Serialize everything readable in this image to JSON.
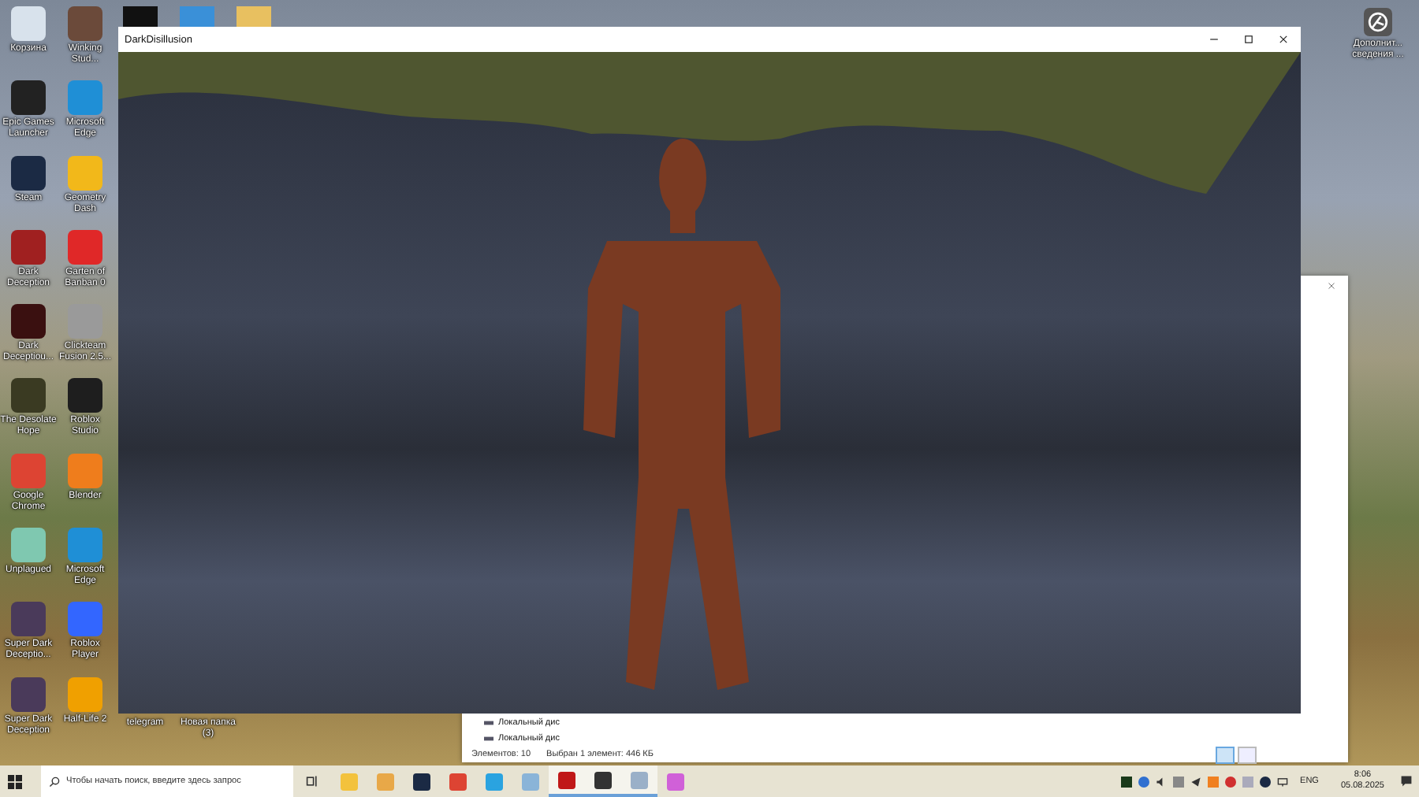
{
  "desktop_icons": [
    {
      "label": "Корзина",
      "color": "#d8e2ec"
    },
    {
      "label": "Winking Stud...",
      "color": "#6b4a3a"
    },
    {
      "label": "Epic Games Launcher",
      "color": "#222222"
    },
    {
      "label": "Microsoft Edge",
      "color": "#1f8fd6"
    },
    {
      "label": "Steam",
      "color": "#1b2a44"
    },
    {
      "label": "Geometry Dash",
      "color": "#f2b81a"
    },
    {
      "label": "Dark Deception",
      "color": "#a02020"
    },
    {
      "label": "Garten of Banban 0",
      "color": "#e02828"
    },
    {
      "label": "Dark Deceptiou...",
      "color": "#3a1010"
    },
    {
      "label": "Clickteam Fusion 2.5...",
      "color": "#9a9a9a"
    },
    {
      "label": "The Desolate Hope",
      "color": "#3a3a22"
    },
    {
      "label": "Roblox Studio",
      "color": "#1e1e1e"
    },
    {
      "label": "Google Chrome",
      "color": "#dd4433"
    },
    {
      "label": "Blender",
      "color": "#ef7d1c"
    },
    {
      "label": "Unplagued",
      "color": "#7fc8b0"
    },
    {
      "label": "Microsoft Edge",
      "color": "#1f8fd6"
    },
    {
      "label": "Super Dark Deceptio...",
      "color": "#4a3a5a"
    },
    {
      "label": "Roblox Player",
      "color": "#3366ff"
    },
    {
      "label": "Super Dark Deception",
      "color": "#4a3a5a"
    },
    {
      "label": "Half-Life 2",
      "color": "#f0a000"
    }
  ],
  "desktop_icons_covered": [
    {
      "label": "telegram"
    },
    {
      "label": "Новая папка (3)"
    }
  ],
  "corner_icon": {
    "label": "Дополнит... сведения ..."
  },
  "explorer": {
    "nav_items": [
      "Локальный дис",
      "Локальный дис"
    ],
    "item_count": "Элементов: 10",
    "selection": "Выбран 1 элемент: 446 КБ"
  },
  "game_window": {
    "title": "DarkDisillusion"
  },
  "taskbar": {
    "search": {
      "placeholder": "Чтобы начать поиск, введите здесь запрос"
    },
    "apps": [
      {
        "color": "#f3c23c",
        "selected": false
      },
      {
        "color": "#e8a848",
        "selected": false
      },
      {
        "color": "#1b2a44",
        "selected": false
      },
      {
        "color": "#dd4433",
        "selected": false
      },
      {
        "color": "#2aa3e0",
        "selected": false
      },
      {
        "color": "#8ab4d8",
        "selected": false
      },
      {
        "color": "#c01818",
        "selected": true
      },
      {
        "color": "#333333",
        "selected": true
      },
      {
        "color": "#9ab0c8",
        "selected": true
      },
      {
        "color": "#d060d8",
        "selected": false
      }
    ],
    "language": "ENG",
    "time": "8:06",
    "date": "05.08.2025"
  }
}
